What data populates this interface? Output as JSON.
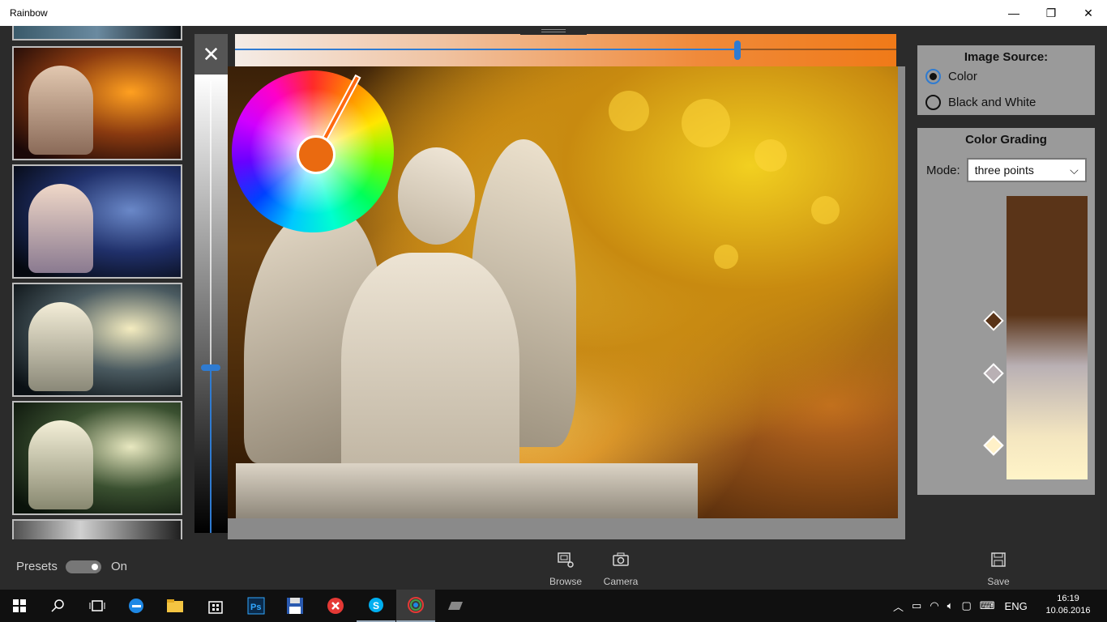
{
  "window": {
    "title": "Rainbow",
    "controls": {
      "minimize": "—",
      "maximize": "❐",
      "close": "✕"
    }
  },
  "colors": {
    "accent": "#2f7bd1",
    "panel_bg": "#9a9a9a",
    "app_bg": "#2b2b2b",
    "hue_selected": "#ea6a10"
  },
  "sliders": {
    "vertical_value": 0.36,
    "hue_value": 0.76
  },
  "close_icon": "✕",
  "image_source": {
    "title": "Image Source:",
    "options": [
      {
        "label": "Color",
        "checked": true
      },
      {
        "label": "Black and White",
        "checked": false
      }
    ]
  },
  "color_grading": {
    "title": "Color Grading",
    "mode_label": "Mode:",
    "mode_value": "three points",
    "dropdown_icon": "⌵",
    "points": [
      {
        "color": "#5a3418"
      },
      {
        "color": "#b9b0b4"
      },
      {
        "color": "#fff1c8"
      }
    ]
  },
  "command_bar": {
    "presets_label": "Presets",
    "toggle_state": "On",
    "browse": {
      "label": "Browse",
      "icon": "browse-icon"
    },
    "camera": {
      "label": "Camera",
      "icon": "camera-icon"
    },
    "save": {
      "label": "Save",
      "icon": "save-icon"
    }
  },
  "taskbar": {
    "lang": "ENG",
    "time": "16:19",
    "date": "10.06.2016",
    "apps": [
      "windows-start",
      "search",
      "task-view",
      "edge",
      "file-explorer",
      "store",
      "photoshop",
      "save-disk",
      "red-x",
      "skype",
      "rainbow",
      "device"
    ]
  }
}
